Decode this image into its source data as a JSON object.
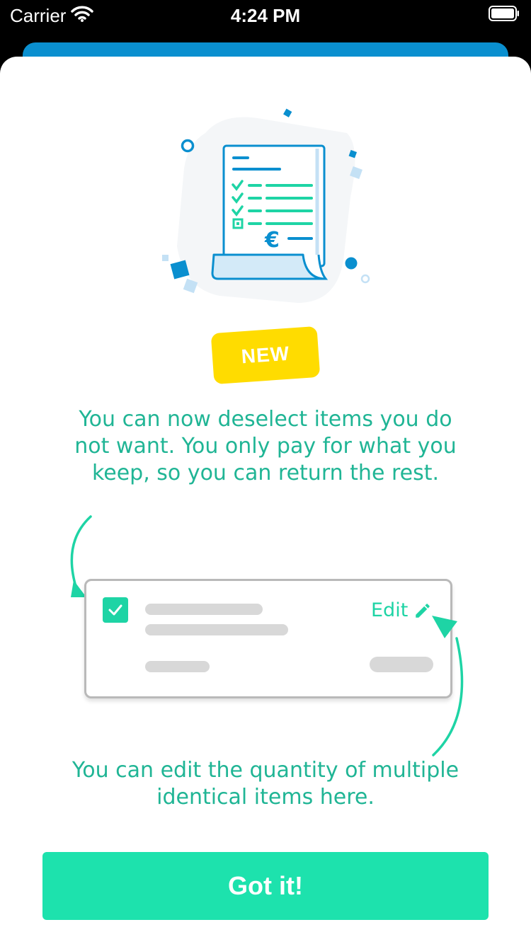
{
  "status_bar": {
    "carrier": "Carrier",
    "time": "4:24 PM"
  },
  "onboarding": {
    "badge": "NEW",
    "intro": "You can now deselect items you do not want. You only pay for what you keep, so you can return the rest.",
    "card": {
      "edit_label": "Edit"
    },
    "hint": "You can edit the quantity of multiple identical items here.",
    "cta_label": "Got it!"
  },
  "colors": {
    "accent_green": "#1de2ad",
    "text_green": "#20b595",
    "badge_yellow": "#ffdc00",
    "brand_blue": "#0a8fcf"
  },
  "icons": [
    "wifi-icon",
    "battery-icon",
    "receipt-illustration",
    "checkbox-checked-icon",
    "pencil-icon",
    "curved-arrow-icon"
  ]
}
